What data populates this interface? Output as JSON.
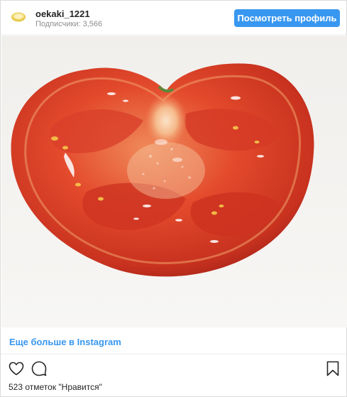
{
  "header": {
    "username": "oekaki_1221",
    "followers": "Подписчики: 3,566",
    "view_profile_label": "Посмотреть профиль",
    "avatar_icon": "lemon-avatar-icon"
  },
  "colors": {
    "accent": "#3897f0",
    "muted_text": "#8e8e8e",
    "text": "#262626",
    "divider": "#efefef"
  },
  "post": {
    "image_subject": "tomato-cross-section-painting"
  },
  "footer": {
    "more_link": "Еще больше в Instagram",
    "likes_text": "523 отметок \"Нравится\"",
    "like_icon": "heart-icon",
    "comment_icon": "comment-icon",
    "save_icon": "bookmark-icon"
  }
}
